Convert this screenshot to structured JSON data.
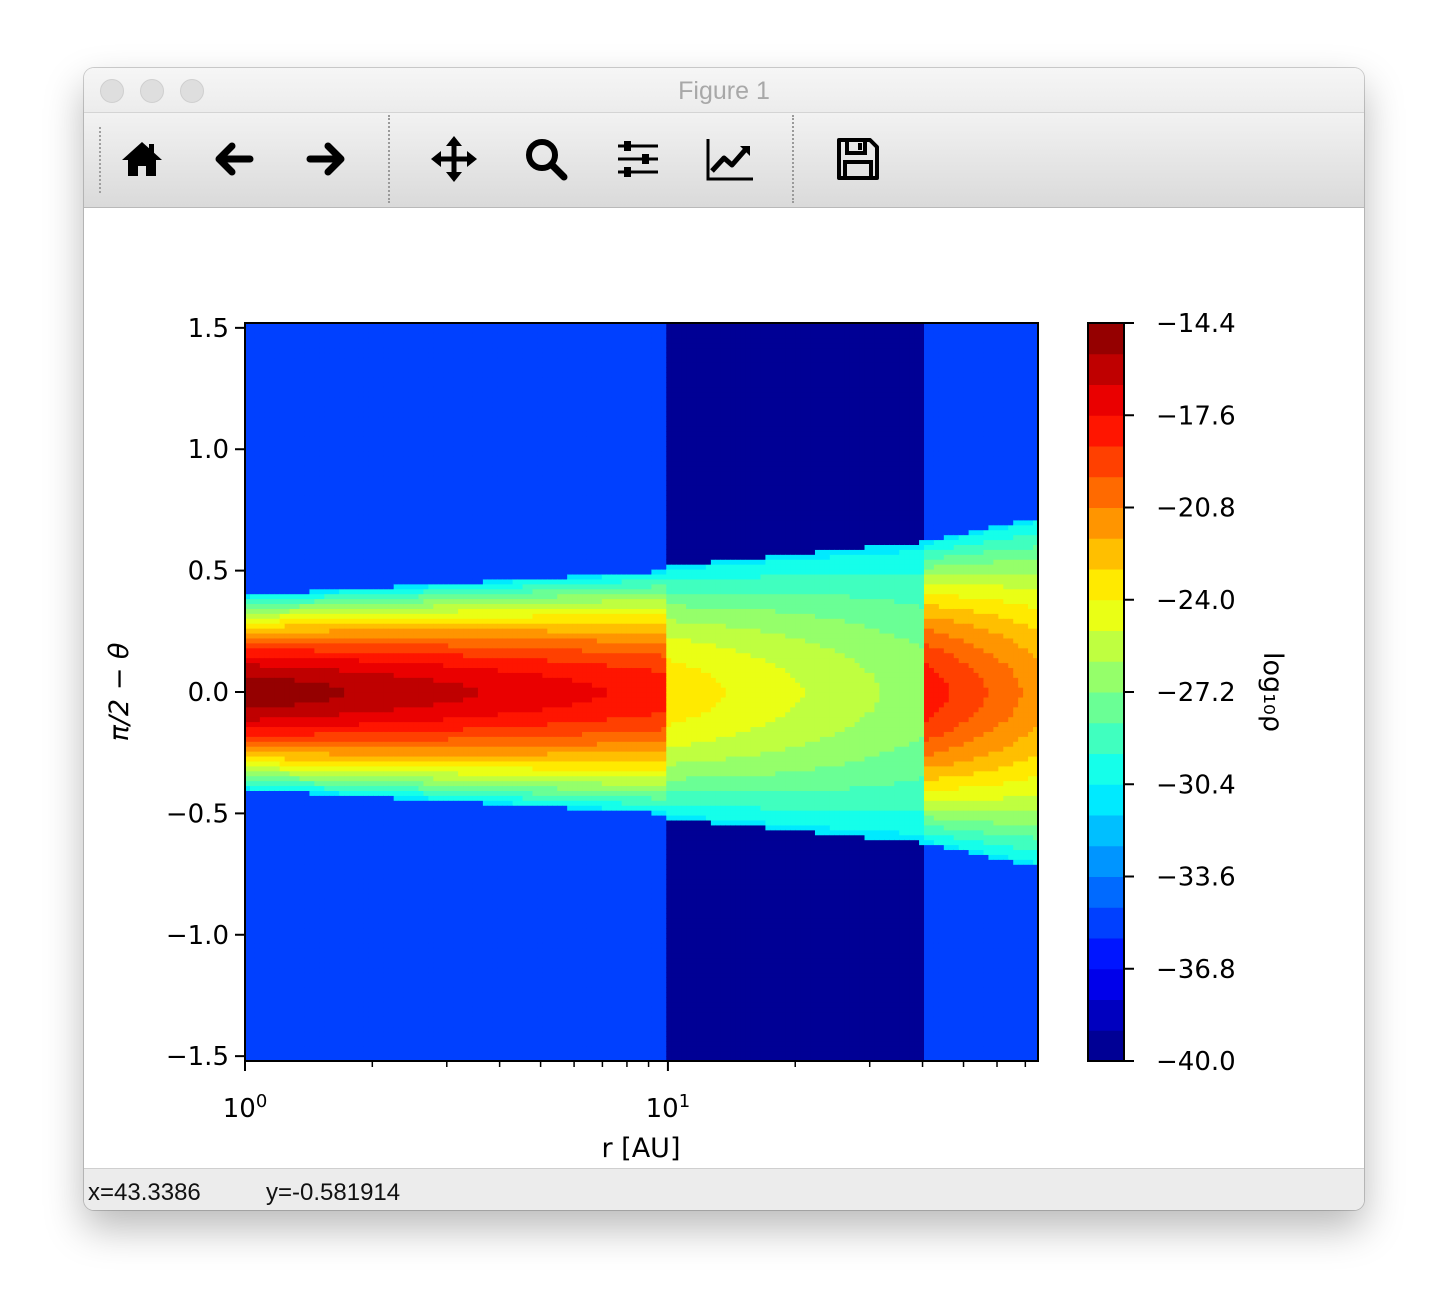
{
  "window": {
    "title": "Figure 1"
  },
  "toolbar": {
    "buttons": [
      {
        "name": "home-button",
        "icon": "home-icon"
      },
      {
        "name": "back-button",
        "icon": "arrow-left-icon"
      },
      {
        "name": "forward-button",
        "icon": "arrow-right-icon"
      },
      {
        "name": "pan-button",
        "icon": "move-arrows-icon"
      },
      {
        "name": "zoom-button",
        "icon": "magnifier-icon"
      },
      {
        "name": "subplots-button",
        "icon": "sliders-icon"
      },
      {
        "name": "edit-axes-button",
        "icon": "line-chart-icon"
      },
      {
        "name": "save-button",
        "icon": "floppy-disk-icon"
      }
    ]
  },
  "status": {
    "x": "x=43.3386",
    "y": "y=-0.581914"
  },
  "chart_data": {
    "type": "heatmap",
    "xlabel": "r [AU]",
    "ylabel": "π/2 − θ",
    "xscale": "log",
    "xlim": [
      1,
      75
    ],
    "ylim": [
      -1.52,
      1.52
    ],
    "xticks": [
      {
        "value": 1,
        "base": "10",
        "exp": "0"
      },
      {
        "value": 10,
        "base": "10",
        "exp": "1"
      }
    ],
    "yticks": [
      {
        "value": 1.5,
        "label": "1.5"
      },
      {
        "value": 1.0,
        "label": "1.0"
      },
      {
        "value": 0.5,
        "label": "0.5"
      },
      {
        "value": 0.0,
        "label": "0.0"
      },
      {
        "value": -0.5,
        "label": "−0.5"
      },
      {
        "value": -1.0,
        "label": "−1.0"
      },
      {
        "value": -1.5,
        "label": "−1.5"
      }
    ],
    "colorbar": {
      "label": "log₁₀ρ",
      "colormap": "jet",
      "range": [
        -40.0,
        -14.4
      ],
      "ticks": [
        {
          "value": -14.4,
          "label": "−14.4"
        },
        {
          "value": -17.6,
          "label": "−17.6"
        },
        {
          "value": -20.8,
          "label": "−20.8"
        },
        {
          "value": -24.0,
          "label": "−24.0"
        },
        {
          "value": -27.2,
          "label": "−27.2"
        },
        {
          "value": -30.4,
          "label": "−30.4"
        },
        {
          "value": -33.6,
          "label": "−33.6"
        },
        {
          "value": -36.8,
          "label": "−36.8"
        },
        {
          "value": -40.0,
          "label": "−40.0"
        }
      ]
    },
    "regions": [
      {
        "r_range": [
          1,
          10
        ],
        "midplane_max": -14.6,
        "background": -35,
        "disk_half_width": [
          0.4,
          0.5
        ]
      },
      {
        "r_range": [
          10,
          40
        ],
        "midplane_max": -23.2,
        "background": -40.0,
        "disk_half_width": [
          0.52,
          0.62
        ]
      },
      {
        "r_range": [
          40,
          75
        ],
        "midplane_max": -17.8,
        "background": -35,
        "disk_half_width": [
          0.62,
          0.72
        ]
      }
    ]
  }
}
